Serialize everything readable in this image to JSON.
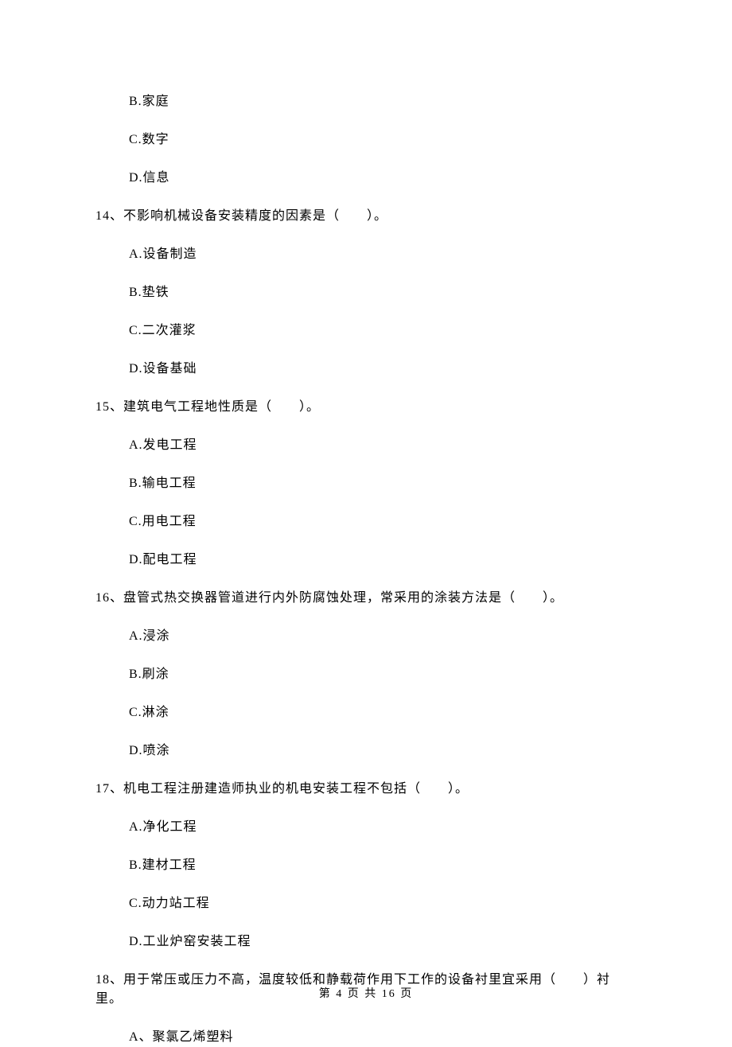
{
  "options_top": [
    "B.家庭",
    "C.数字",
    "D.信息"
  ],
  "questions": [
    {
      "stem": "14、不影响机械设备安装精度的因素是（　　）。",
      "options": [
        "A.设备制造",
        "B.垫铁",
        "C.二次灌浆",
        "D.设备基础"
      ]
    },
    {
      "stem": "15、建筑电气工程地性质是（　　）。",
      "options": [
        "A.发电工程",
        "B.输电工程",
        "C.用电工程",
        "D.配电工程"
      ]
    },
    {
      "stem": "16、盘管式热交换器管道进行内外防腐蚀处理，常采用的涂装方法是（　　）。",
      "options": [
        "A.浸涂",
        "B.刷涂",
        "C.淋涂",
        "D.喷涂"
      ]
    },
    {
      "stem": "17、机电工程注册建造师执业的机电安装工程不包括（　　）。",
      "options": [
        "A.净化工程",
        "B.建材工程",
        "C.动力站工程",
        "D.工业炉窑安装工程"
      ]
    },
    {
      "stem": "18、用于常压或压力不高，温度较低和静载荷作用下工作的设备衬里宜采用（　　）衬里。",
      "options": [
        "A、聚氯乙烯塑料"
      ]
    }
  ],
  "footer": "第 4 页 共 16 页"
}
